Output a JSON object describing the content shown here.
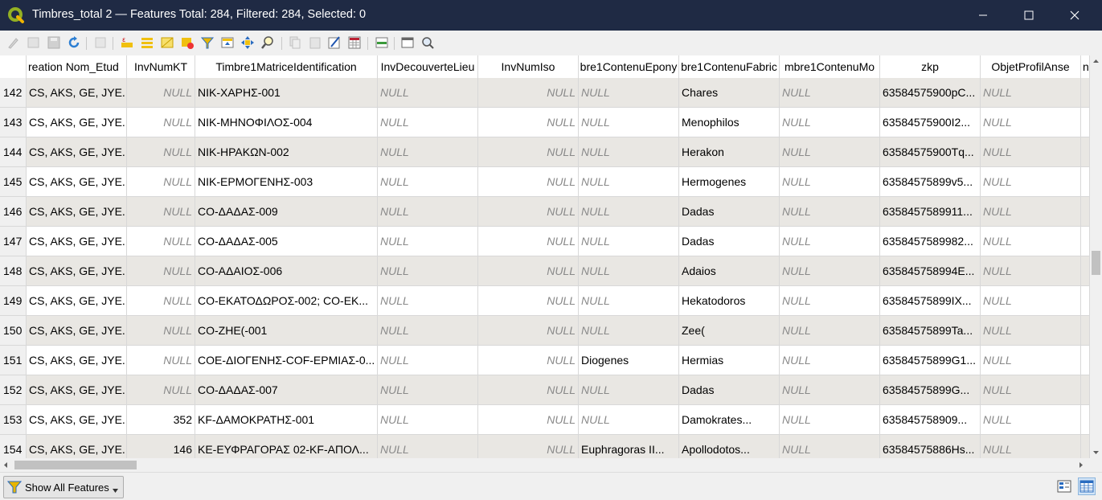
{
  "window": {
    "title": "Timbres_total 2 — Features Total: 284, Filtered: 284, Selected: 0",
    "app_icon": "qgis-logo-icon"
  },
  "toolbar": {
    "buttons": [
      "toggle-editing-icon",
      "multi-edit-icon",
      "save-edits-icon",
      "reload-icon",
      "add-feature-icon",
      "delete-selected-icon",
      "select-by-expression-icon",
      "select-all-icon",
      "invert-selection-icon",
      "deselect-all-icon",
      "filter-select-icon",
      "move-selection-top-icon",
      "pan-to-selected-icon",
      "zoom-to-selected-icon",
      "copy-rows-icon",
      "paste-features-icon",
      "delete-field-icon",
      "new-field-icon",
      "field-calculator-icon",
      "conditional-formatting-icon",
      "dock-table-icon",
      "actions-icon"
    ]
  },
  "table": {
    "columns": [
      "reation Nom_Etud",
      "InvNumKT",
      "Timbre1MatriceIdentification",
      "InvDecouverteLieu",
      "InvNumIso",
      "bre1ContenuEpony",
      "bre1ContenuFabric",
      "mbre1ContenuMo",
      "zkp",
      "ObjetProfilAnse",
      "n"
    ],
    "null_label": "NULL",
    "rows": [
      {
        "id": "142",
        "c0": "CS, AKS, GE, JYE...",
        "c1": "NULL",
        "c2": "ΝΙΚ-ΧΑΡΗΣ-001",
        "c3": "NULL",
        "c4": "NULL",
        "c5": "NULL",
        "c6": "Chares",
        "c7": "NULL",
        "c8": "63584575900pC...",
        "c9": "NULL"
      },
      {
        "id": "143",
        "c0": "CS, AKS, GE, JYE...",
        "c1": "NULL",
        "c2": "ΝΙΚ-ΜΗΝΟΦΙΛΟΣ-004",
        "c3": "NULL",
        "c4": "NULL",
        "c5": "NULL",
        "c6": "Menophilos",
        "c7": "NULL",
        "c8": "63584575900I2...",
        "c9": "NULL"
      },
      {
        "id": "144",
        "c0": "CS, AKS, GE, JYE...",
        "c1": "NULL",
        "c2": "ΝΙΚ-ΗΡΑΚΩΝ-002",
        "c3": "NULL",
        "c4": "NULL",
        "c5": "NULL",
        "c6": "Herakon",
        "c7": "NULL",
        "c8": "63584575900Tq...",
        "c9": "NULL"
      },
      {
        "id": "145",
        "c0": "CS, AKS, GE, JYE...",
        "c1": "NULL",
        "c2": "ΝΙΚ-ΕΡΜΟΓΕΝΗΣ-003",
        "c3": "NULL",
        "c4": "NULL",
        "c5": "NULL",
        "c6": "Hermogenes",
        "c7": "NULL",
        "c8": "63584575899v5...",
        "c9": "NULL"
      },
      {
        "id": "146",
        "c0": "CS, AKS, GE, JYE...",
        "c1": "NULL",
        "c2": "CO-ΔΑΔΑΣ-009",
        "c3": "NULL",
        "c4": "NULL",
        "c5": "NULL",
        "c6": "Dadas",
        "c7": "NULL",
        "c8": "6358457589911...",
        "c9": "NULL"
      },
      {
        "id": "147",
        "c0": "CS, AKS, GE, JYE...",
        "c1": "NULL",
        "c2": "CO-ΔΑΔΑΣ-005",
        "c3": "NULL",
        "c4": "NULL",
        "c5": "NULL",
        "c6": "Dadas",
        "c7": "NULL",
        "c8": "6358457589982...",
        "c9": "NULL"
      },
      {
        "id": "148",
        "c0": "CS, AKS, GE, JYE...",
        "c1": "NULL",
        "c2": "CO-ΑΔΑΙΟΣ-006",
        "c3": "NULL",
        "c4": "NULL",
        "c5": "NULL",
        "c6": "Adaios",
        "c7": "NULL",
        "c8": "635845758994E...",
        "c9": "NULL"
      },
      {
        "id": "149",
        "c0": "CS, AKS, GE, JYE...",
        "c1": "NULL",
        "c2": "CO-ΕΚΑΤΟΔΩΡΟΣ-002; CO-ΕΚ...",
        "c3": "NULL",
        "c4": "NULL",
        "c5": "NULL",
        "c6": "Hekatodoros",
        "c7": "NULL",
        "c8": "63584575899IX...",
        "c9": "NULL"
      },
      {
        "id": "150",
        "c0": "CS, AKS, GE, JYE...",
        "c1": "NULL",
        "c2": "CO-ΖΗΕ(-001",
        "c3": "NULL",
        "c4": "NULL",
        "c5": "NULL",
        "c6": "Zee(",
        "c7": "NULL",
        "c8": "63584575899Ta...",
        "c9": "NULL"
      },
      {
        "id": "151",
        "c0": "CS, AKS, GE, JYE...",
        "c1": "NULL",
        "c2": "COE-ΔΙΟΓΕΝΗΣ-COF-ΕΡΜΙΑΣ-0...",
        "c3": "NULL",
        "c4": "NULL",
        "c5": "Diogenes",
        "c6": "Hermias",
        "c7": "NULL",
        "c8": "63584575899G1...",
        "c9": "NULL"
      },
      {
        "id": "152",
        "c0": "CS, AKS, GE, JYE...",
        "c1": "NULL",
        "c2": "CO-ΔΑΔΑΣ-007",
        "c3": "NULL",
        "c4": "NULL",
        "c5": "NULL",
        "c6": "Dadas",
        "c7": "NULL",
        "c8": "63584575899G...",
        "c9": "NULL"
      },
      {
        "id": "153",
        "c0": "CS, AKS, GE, JYE...",
        "c1": "352",
        "c2": "KF-ΔΑΜΟΚΡΑΤΗΣ-001",
        "c3": "NULL",
        "c4": "NULL",
        "c5": "NULL",
        "c6": "Damokrates...",
        "c7": "NULL",
        "c8": "635845758909...",
        "c9": "NULL"
      },
      {
        "id": "154",
        "c0": "CS, AKS, GE, JYE...",
        "c1": "146",
        "c2": "KE-ΕΥΦΡΑΓΟΡΑΣ 02-KF-ΑΠΟΛ...",
        "c3": "NULL",
        "c4": "NULL",
        "c5": "Euphragoras II...",
        "c6": "Apollodotos...",
        "c7": "NULL",
        "c8": "63584575886Hs...",
        "c9": "NULL"
      }
    ]
  },
  "bottom": {
    "show_all_label": "Show All Features",
    "form_view_icon": "form-view-icon",
    "table_view_icon": "table-view-icon"
  }
}
